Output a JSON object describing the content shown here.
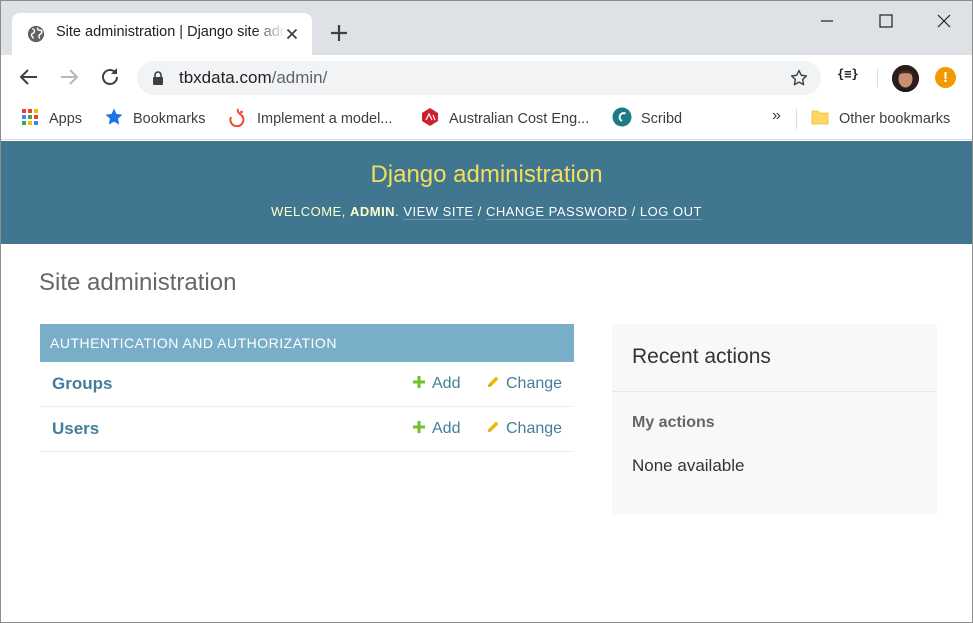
{
  "browser": {
    "tab_title": "Site administration | Django site admin",
    "url_host": "tbxdata.com",
    "url_path": "/admin/",
    "extension_label": "{≡}",
    "alert_label": "!",
    "bookmarks": [
      {
        "label": "Apps",
        "icon": "apps-grid-icon"
      },
      {
        "label": "Bookmarks",
        "icon": "star-icon"
      },
      {
        "label": "Implement a model...",
        "icon": "tensorflow-icon"
      },
      {
        "label": "Australian Cost Eng...",
        "icon": "acostea-icon"
      },
      {
        "label": "Scribd",
        "icon": "scribd-icon"
      }
    ],
    "overflow_label": "»",
    "other_bookmarks": "Other bookmarks"
  },
  "django": {
    "branding": "Django administration",
    "welcome": "Welcome,",
    "username": "admin",
    "view_site": "View site",
    "change_password": "Change password",
    "log_out": "Log out",
    "separator": "/",
    "page_title": "Site administration",
    "app": {
      "caption": "Authentication and Authorization",
      "models": [
        {
          "name": "Groups",
          "add": "Add",
          "change": "Change"
        },
        {
          "name": "Users",
          "add": "Add",
          "change": "Change"
        }
      ]
    },
    "recent": {
      "title": "Recent actions",
      "subtitle": "My actions",
      "empty": "None available"
    }
  },
  "colors": {
    "header_bg": "#417690",
    "branding": "#f5dd5d",
    "caption_bg": "#79aec8",
    "link": "#447e9b",
    "add_icon": "#70bf2b",
    "change_icon": "#efb80b"
  }
}
